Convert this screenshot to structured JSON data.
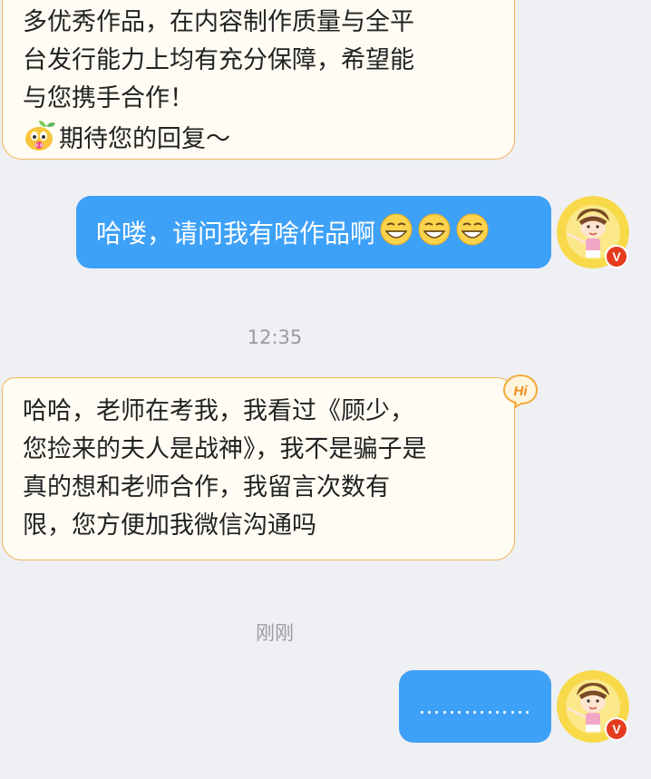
{
  "messages": [
    {
      "id": "m1",
      "direction": "incoming",
      "lines": [
        "多优秀作品，在内容制作质量与全平",
        "台发行能力上均有充分保障，希望能",
        "与您携手合作！",
        "期待您的回复～"
      ],
      "emoji": "sprout-face-emoji"
    },
    {
      "id": "m2",
      "direction": "outgoing",
      "text": "哈喽，请问我有啥作品啊",
      "emojis": [
        "grin-emoji",
        "grin-emoji",
        "grin-emoji"
      ]
    },
    {
      "id": "t1",
      "type": "timestamp",
      "text": "12:35"
    },
    {
      "id": "m3",
      "direction": "incoming",
      "badge": "Hi",
      "lines": [
        "哈哈，老师在考我，我看过《顾少，",
        "您捡来的夫人是战神》，我不是骗子是",
        "真的想和老师合作，我留言次数有",
        "限，您方便加我微信沟通吗"
      ]
    },
    {
      "id": "t2",
      "type": "timestamp",
      "text": "刚刚"
    },
    {
      "id": "m4",
      "direction": "outgoing",
      "text": "……………"
    }
  ],
  "avatar": {
    "name": "user-avatar",
    "verified_badge": "V",
    "badge_color": "#e53b1e",
    "ring_color": "#f7d94a"
  },
  "colors": {
    "background": "#eff0f3",
    "incoming_bubble": "#fffcf3",
    "incoming_border": "#f3b25b",
    "outgoing_bubble": "#3ea1f8",
    "timestamp_text": "#9a9ca3"
  }
}
